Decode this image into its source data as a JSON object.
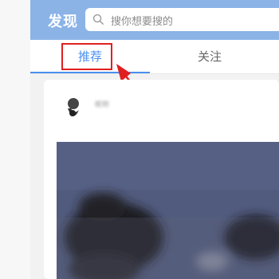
{
  "header": {
    "title": "发现",
    "search_placeholder": "搜你想要搜的"
  },
  "tabs": [
    {
      "label": "推荐",
      "active": true
    },
    {
      "label": "关注",
      "active": false
    }
  ],
  "annotation": {
    "highlight_color": "#e02020"
  },
  "card": {
    "author_name": "昵称",
    "image_description_color": "#505a7c"
  },
  "colors": {
    "header_bg": "#8bb3e6",
    "accent": "#4a8ff0"
  }
}
